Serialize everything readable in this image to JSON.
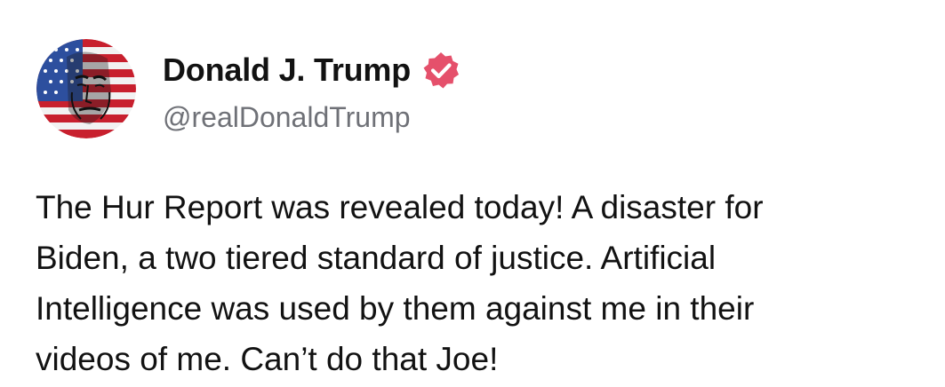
{
  "post": {
    "author": {
      "display_name": "Donald J. Trump",
      "handle": "@realDonaldTrump",
      "verified": true,
      "avatar_icon": "flag-portrait-avatar-icon",
      "verified_icon": "verified-badge-icon"
    },
    "text": "The Hur Report was revealed today! A disaster for\nBiden, a two tiered standard of justice. Artificial\nIntelligence was used by them against me in their\nvideos of me. Can’t do that Joe!"
  },
  "colors": {
    "background": "#ffffff",
    "name": "#121212",
    "handle": "#6f7177",
    "body": "#121212",
    "verified_badge": "#e5506b"
  }
}
